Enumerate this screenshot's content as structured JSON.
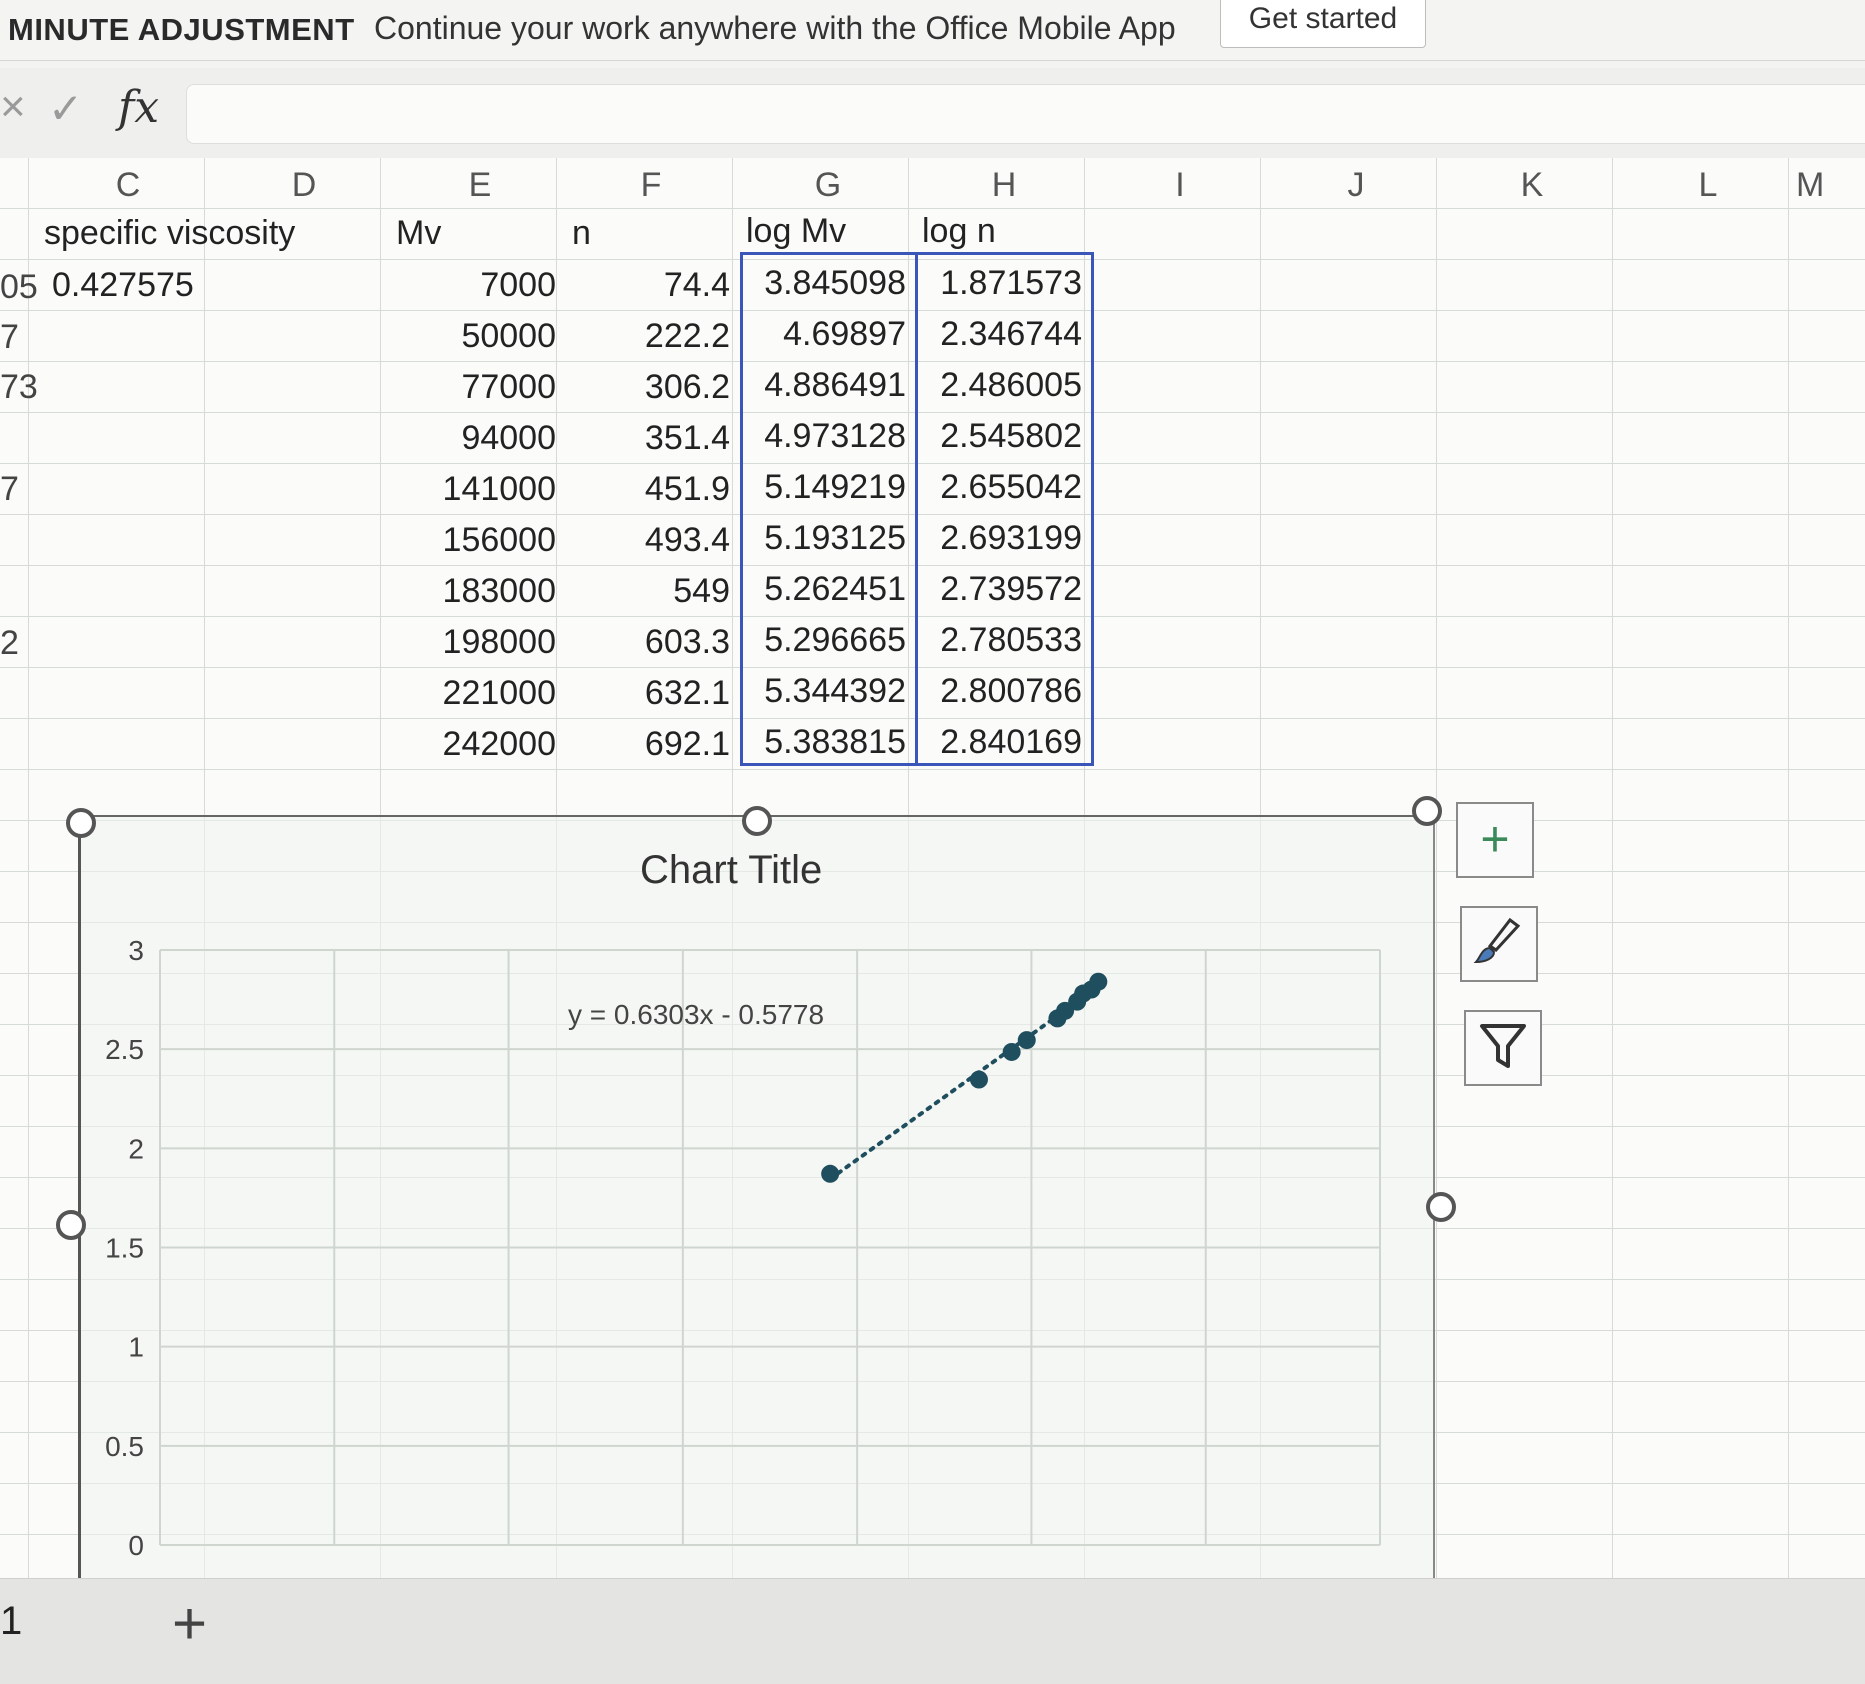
{
  "banner": {
    "title": "MINUTE ADJUSTMENT",
    "message": "Continue your work anywhere with the Office Mobile App",
    "button": "Get started"
  },
  "formula_bar": {
    "cancel": "×",
    "enter": "✓",
    "fx": "fx",
    "value": ""
  },
  "columns": [
    "C",
    "D",
    "E",
    "F",
    "G",
    "H",
    "I",
    "J",
    "K",
    "L",
    "M"
  ],
  "headers": {
    "c": "specific viscosity",
    "e": "Mv",
    "f": "n",
    "g": "log Mv",
    "h": "log n"
  },
  "row_fragments": [
    "05",
    "7",
    "73",
    "",
    "7",
    "",
    "",
    "2",
    "",
    ""
  ],
  "specific_viscosity_first": "0.427575",
  "rows": [
    {
      "mv": "7000",
      "n": "74.4",
      "log_mv": "3.845098",
      "log_n": "1.871573"
    },
    {
      "mv": "50000",
      "n": "222.2",
      "log_mv": "4.69897",
      "log_n": "2.346744"
    },
    {
      "mv": "77000",
      "n": "306.2",
      "log_mv": "4.886491",
      "log_n": "2.486005"
    },
    {
      "mv": "94000",
      "n": "351.4",
      "log_mv": "4.973128",
      "log_n": "2.545802"
    },
    {
      "mv": "141000",
      "n": "451.9",
      "log_mv": "5.149219",
      "log_n": "2.655042"
    },
    {
      "mv": "156000",
      "n": "493.4",
      "log_mv": "5.193125",
      "log_n": "2.693199"
    },
    {
      "mv": "183000",
      "n": "549",
      "log_mv": "5.262451",
      "log_n": "2.739572"
    },
    {
      "mv": "198000",
      "n": "603.3",
      "log_mv": "5.296665",
      "log_n": "2.780533"
    },
    {
      "mv": "221000",
      "n": "632.1",
      "log_mv": "5.344392",
      "log_n": "2.800786"
    },
    {
      "mv": "242000",
      "n": "692.1",
      "log_mv": "5.383815",
      "log_n": "2.840169"
    }
  ],
  "chart_data": {
    "type": "scatter",
    "title": "Chart Title",
    "trendline_label": "y = 0.6303x - 0.5778",
    "trendline": {
      "slope": 0.6303,
      "intercept": -0.5778
    },
    "x": [
      3.845098,
      4.69897,
      4.886491,
      4.973128,
      5.149219,
      5.193125,
      5.262451,
      5.296665,
      5.344392,
      5.383815
    ],
    "y": [
      1.871573,
      2.346744,
      2.486005,
      2.545802,
      2.655042,
      2.693199,
      2.739572,
      2.780533,
      2.800786,
      2.840169
    ],
    "y_ticks": [
      "0",
      "0.5",
      "1",
      "1.5",
      "2",
      "2.5",
      "3"
    ],
    "ylim": [
      0,
      3
    ],
    "grid": true,
    "marker_color": "#1f4e5f"
  },
  "chart_tools": {
    "add": "+",
    "style": "brush-icon",
    "filter": "filter-icon"
  },
  "sheet_tabs": {
    "current": "1",
    "add": "+"
  }
}
